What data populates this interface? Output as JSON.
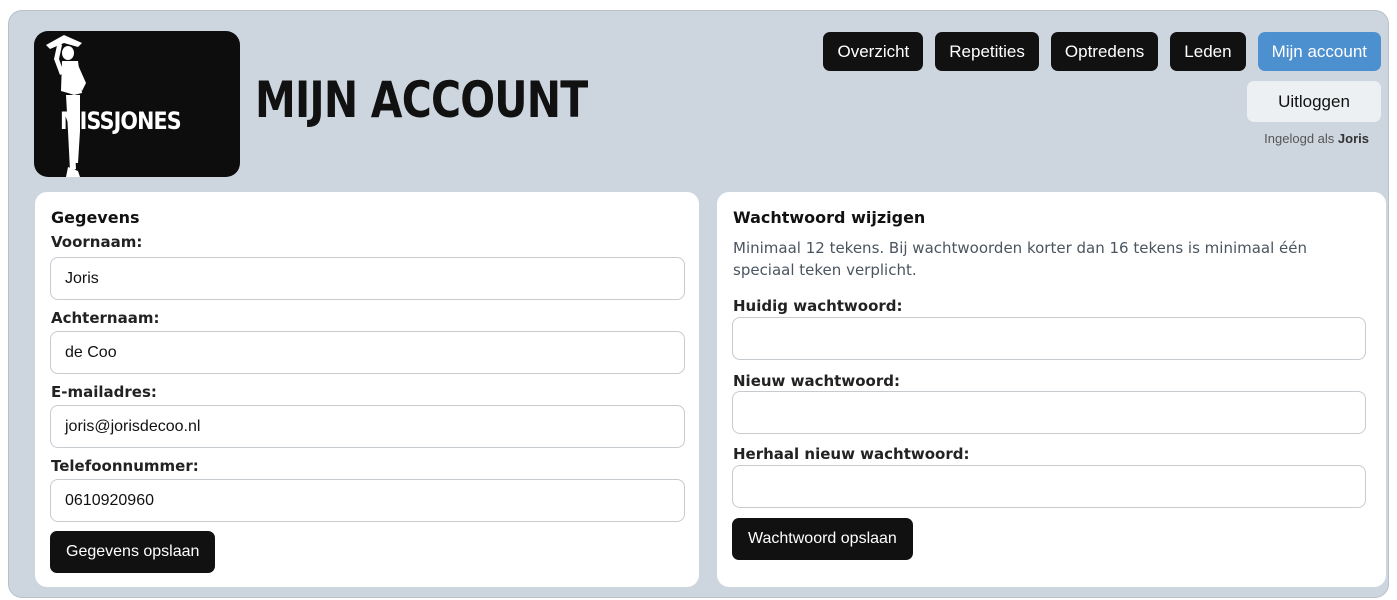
{
  "header": {
    "logo_text": "MISSJONES",
    "page_title": "MIJN ACCOUNT",
    "nav": [
      {
        "label": "Overzicht",
        "active": false
      },
      {
        "label": "Repetities",
        "active": false
      },
      {
        "label": "Optredens",
        "active": false
      },
      {
        "label": "Leden",
        "active": false
      },
      {
        "label": "Mijn account",
        "active": true
      }
    ],
    "logout_label": "Uitloggen",
    "logged_in_prefix": "Ingelogd als",
    "logged_in_user": "Joris",
    "accent_color": "#4d90cf"
  },
  "details": {
    "title": "Gegevens",
    "fields": [
      {
        "label": "Voornaam:",
        "value": "Joris"
      },
      {
        "label": "Achternaam:",
        "value": "de Coo"
      },
      {
        "label": "E-mailadres:",
        "value": "joris@jorisdecoo.nl"
      },
      {
        "label": "Telefoonnummer:",
        "value": "0610920960"
      }
    ],
    "save_label": "Gegevens opslaan"
  },
  "password": {
    "title": "Wachtwoord wijzigen",
    "help": "Minimaal 12 tekens. Bij wachtwoorden korter dan 16 tekens is minimaal één speciaal teken verplicht.",
    "fields": [
      {
        "label": "Huidig wachtwoord:",
        "value": ""
      },
      {
        "label": "Nieuw wachtwoord:",
        "value": ""
      },
      {
        "label": "Herhaal nieuw wachtwoord:",
        "value": ""
      }
    ],
    "save_label": "Wachtwoord opslaan"
  }
}
